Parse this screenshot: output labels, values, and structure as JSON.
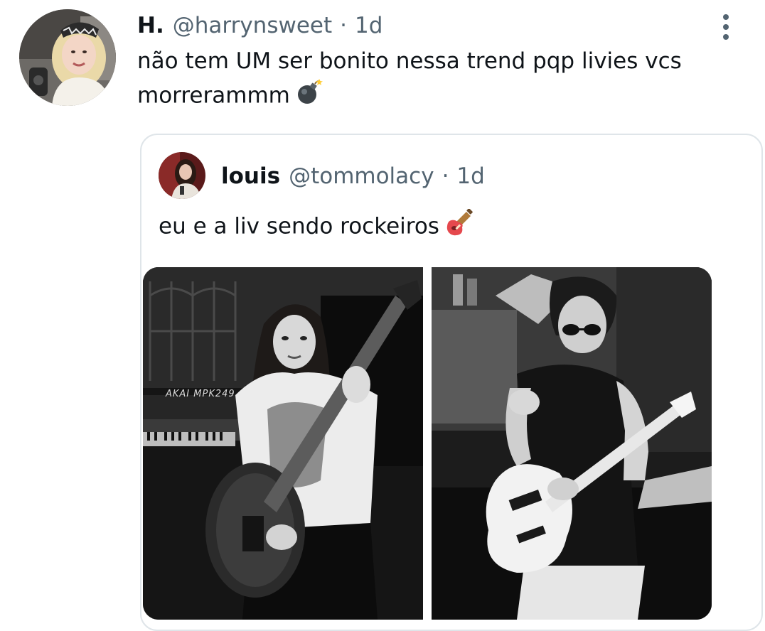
{
  "tweet": {
    "author": {
      "display_name": "H.",
      "handle": "@harrynsweet",
      "avatar": "avatar-blonde-checkered-beret"
    },
    "separator": "·",
    "time": "1d",
    "text": "não tem UM ser bonito nessa trend pqp livies vcs morrerammm",
    "emoji": "bomb-emoji",
    "menu_icon": "more-vertical-icon"
  },
  "quoted_tweet": {
    "author": {
      "display_name": "louis",
      "handle": "@tommolacy",
      "avatar": "avatar-dark-hair-portrait"
    },
    "separator": "·",
    "time": "1d",
    "text": "eu e a liv sendo rockeiros",
    "emoji": "guitar-emoji",
    "media": [
      {
        "name": "photo-girl-with-guitar",
        "style": "black-and-white",
        "caption_in_image": "AKAI MPK249"
      },
      {
        "name": "photo-man-with-guitar",
        "style": "black-and-white"
      }
    ]
  },
  "colors": {
    "text_primary": "#0f1419",
    "text_secondary": "#536471",
    "card_border": "#dfe5e9",
    "background": "#ffffff"
  }
}
